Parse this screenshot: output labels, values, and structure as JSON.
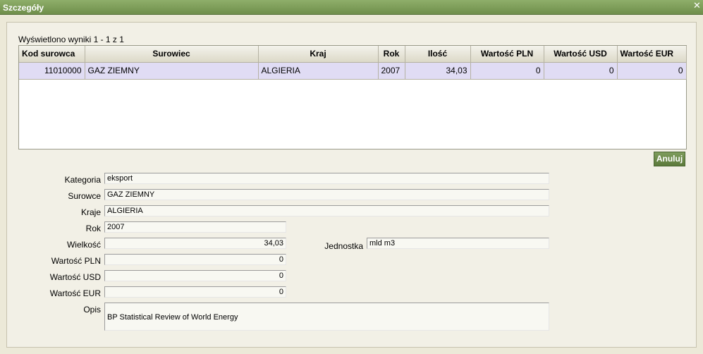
{
  "window": {
    "title": "Szczegóły",
    "close_symbol": "✕"
  },
  "results_info": "Wyświetlono wyniki 1 - 1 z 1",
  "table": {
    "columns": [
      "Kod surowca",
      "Surowiec",
      "Kraj",
      "Rok",
      "Ilość",
      "Wartość PLN",
      "Wartość USD",
      "Wartość EUR"
    ],
    "rows": [
      [
        "11010000",
        "GAZ ZIEMNY",
        "ALGIERIA",
        "2007",
        "34,03",
        "0",
        "0",
        "0"
      ]
    ]
  },
  "buttons": {
    "cancel": "Anuluj"
  },
  "form": {
    "kategoria": {
      "label": "Kategoria",
      "value": "eksport"
    },
    "surowce": {
      "label": "Surowce",
      "value": "GAZ ZIEMNY"
    },
    "kraje": {
      "label": "Kraje",
      "value": "ALGIERIA"
    },
    "rok": {
      "label": "Rok",
      "value": "2007"
    },
    "wielkosc": {
      "label": "Wielkość",
      "value": "34,03"
    },
    "jednostka": {
      "label": "Jednostka",
      "value": "mld m3"
    },
    "wartosc_pln": {
      "label": "Wartość PLN",
      "value": "0"
    },
    "wartosc_usd": {
      "label": "Wartość USD",
      "value": "0"
    },
    "wartosc_eur": {
      "label": "Wartość EUR",
      "value": "0"
    },
    "opis": {
      "label": "Opis",
      "value": "BP Statistical Review of World Energy"
    }
  }
}
